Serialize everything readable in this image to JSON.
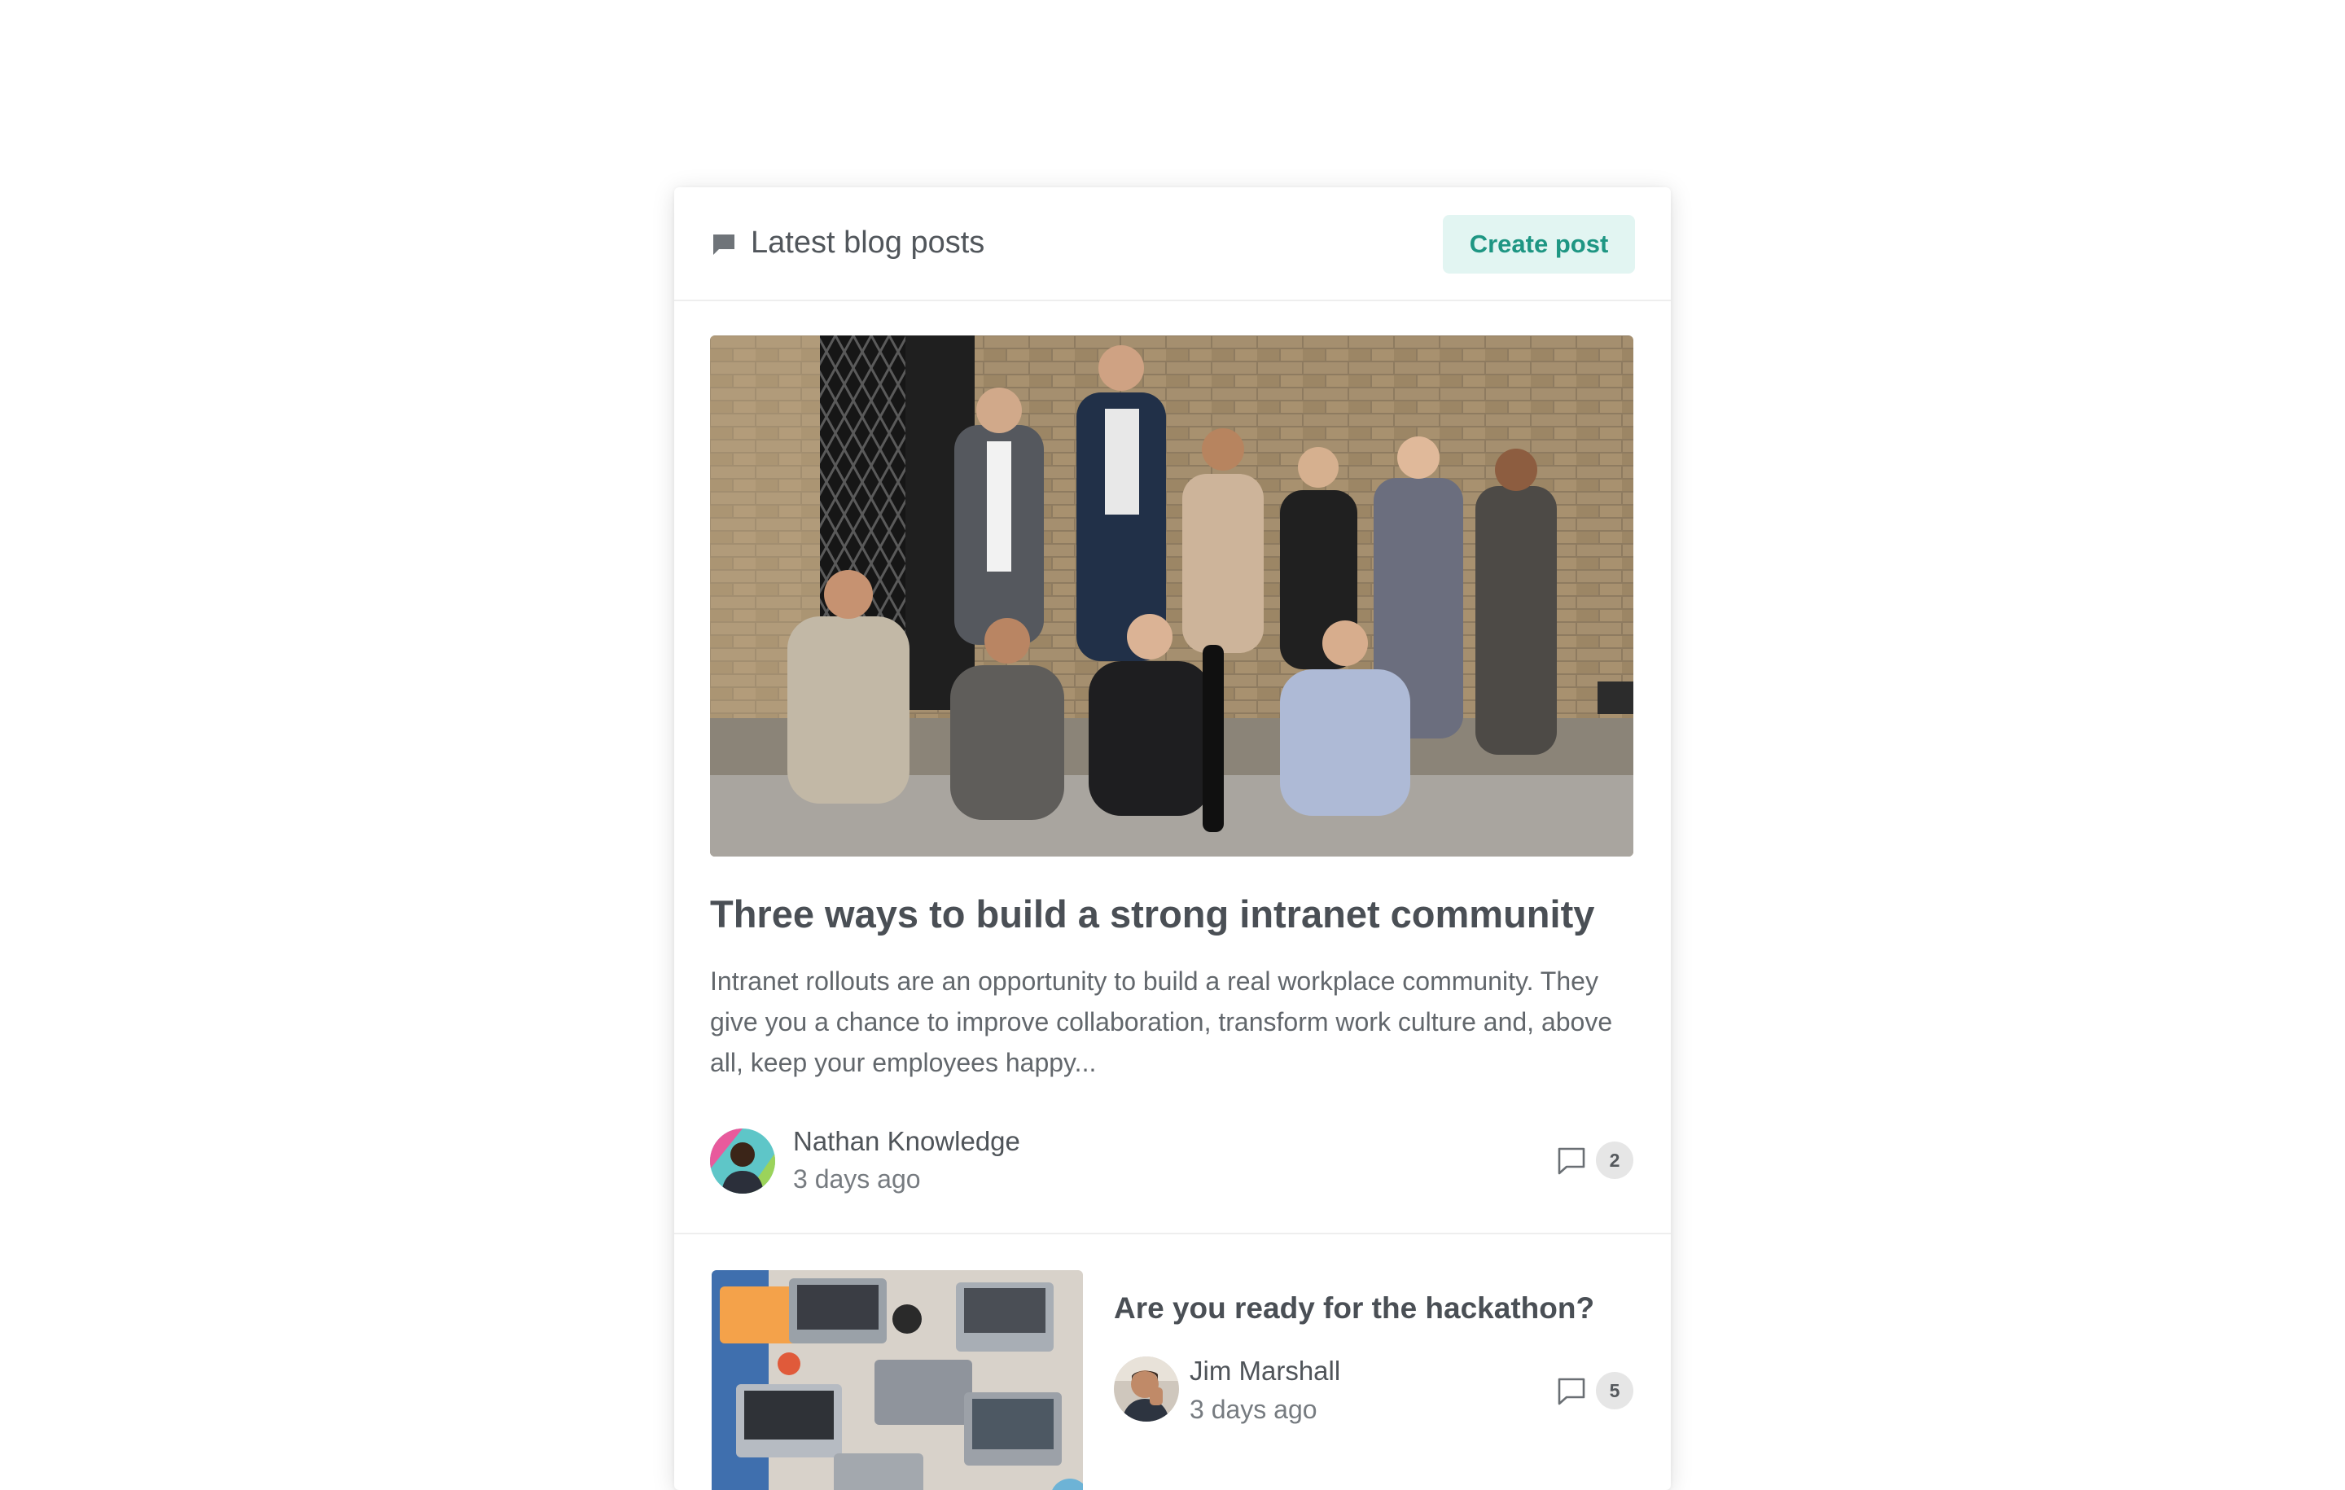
{
  "widget": {
    "title": "Latest blog posts",
    "title_icon": "blog-icon",
    "create_button_label": "Create post",
    "accent_color": "#1e9683",
    "accent_bg": "#e2f5f2"
  },
  "featured_post": {
    "title": "Three ways to build a strong intranet community",
    "excerpt": "Intranet rollouts are an opportunity to build a real workplace community. They give you a chance to improve collaboration, transform work culture and, above all, keep your employees happy...",
    "author": "Nathan Knowledge",
    "time": "3 days ago",
    "comment_count": "2",
    "comment_icon": "comment-icon",
    "image_alt": "Group photo of team in front of brick wall"
  },
  "posts": [
    {
      "title": "Are you ready for the hackathon?",
      "author": "Jim Marshall",
      "time": "3 days ago",
      "comment_count": "5",
      "comment_icon": "comment-icon",
      "image_alt": "Overhead view of laptops on a desk"
    }
  ]
}
